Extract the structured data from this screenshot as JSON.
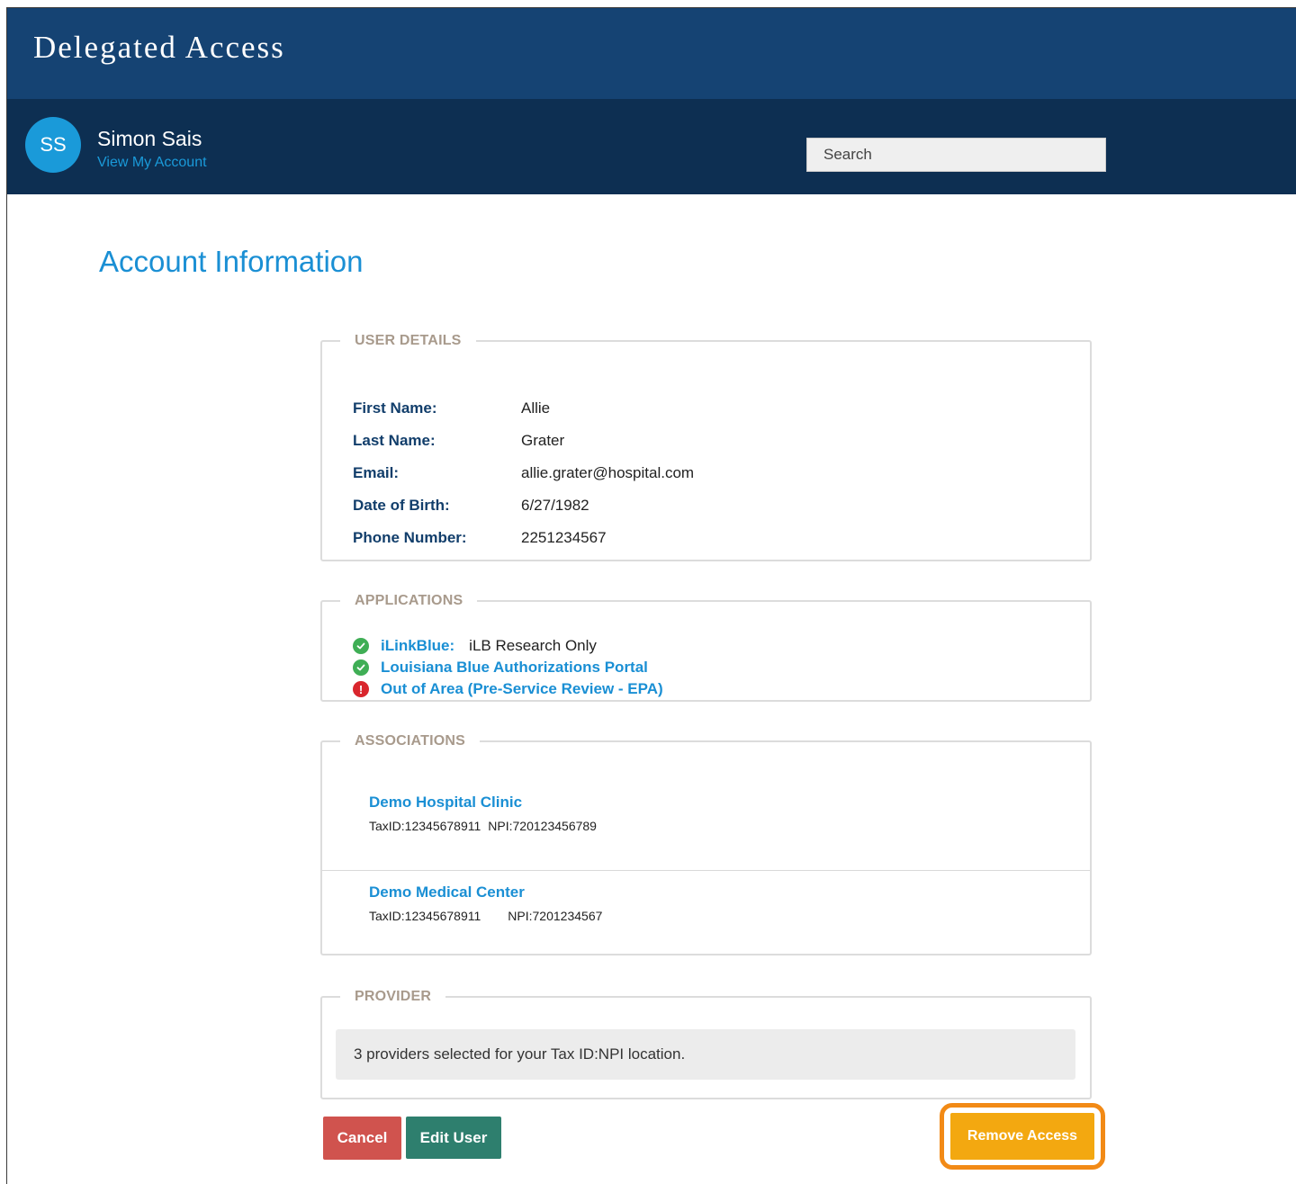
{
  "app": {
    "title": "Delegated Access"
  },
  "user": {
    "initials": "SS",
    "name": "Simon Sais",
    "account_link": "View My Account"
  },
  "search": {
    "placeholder": "Search"
  },
  "page": {
    "title": "Account Information"
  },
  "user_details": {
    "legend": "USER DETAILS",
    "rows": [
      {
        "label": "First Name:",
        "value": "Allie"
      },
      {
        "label": "Last Name:",
        "value": "Grater"
      },
      {
        "label": "Email:",
        "value": "allie.grater@hospital.com"
      },
      {
        "label": "Date of Birth:",
        "value": "6/27/1982"
      },
      {
        "label": "Phone Number:",
        "value": "2251234567"
      }
    ]
  },
  "applications": {
    "legend": "APPLICATIONS",
    "items": [
      {
        "name": "iLinkBlue:",
        "detail": "iLB Research Only",
        "status": "ok",
        "icon": "check-circle-icon"
      },
      {
        "name": "Louisiana Blue Authorizations Portal",
        "detail": "",
        "status": "ok",
        "icon": "check-circle-icon"
      },
      {
        "name": "Out of Area (Pre-Service Review - EPA)",
        "detail": "",
        "status": "warning",
        "icon": "exclamation-circle-icon",
        "icon_glyph": "!"
      }
    ]
  },
  "associations": {
    "legend": "ASSOCIATIONS",
    "items": [
      {
        "name": "Demo Hospital Clinic",
        "tax_id": "TaxID:12345678911",
        "npi": "NPI:720123456789"
      },
      {
        "name": "Demo Medical Center",
        "tax_id": "TaxID:12345678911",
        "npi": "NPI:7201234567"
      }
    ]
  },
  "provider": {
    "legend": "PROVIDER",
    "summary": "3 providers selected for your Tax ID:NPI location."
  },
  "actions": {
    "cancel": "Cancel",
    "edit": "Edit User",
    "remove": "Remove Access"
  },
  "colors": {
    "header": "#154373",
    "user_bar": "#0d2f52",
    "accent": "#1a8fd4",
    "cancel": "#d0534e",
    "edit": "#2e7f6e",
    "remove": "#f3a810",
    "highlight": "#f28a16",
    "ok": "#3fae55",
    "warning": "#d9262d"
  }
}
